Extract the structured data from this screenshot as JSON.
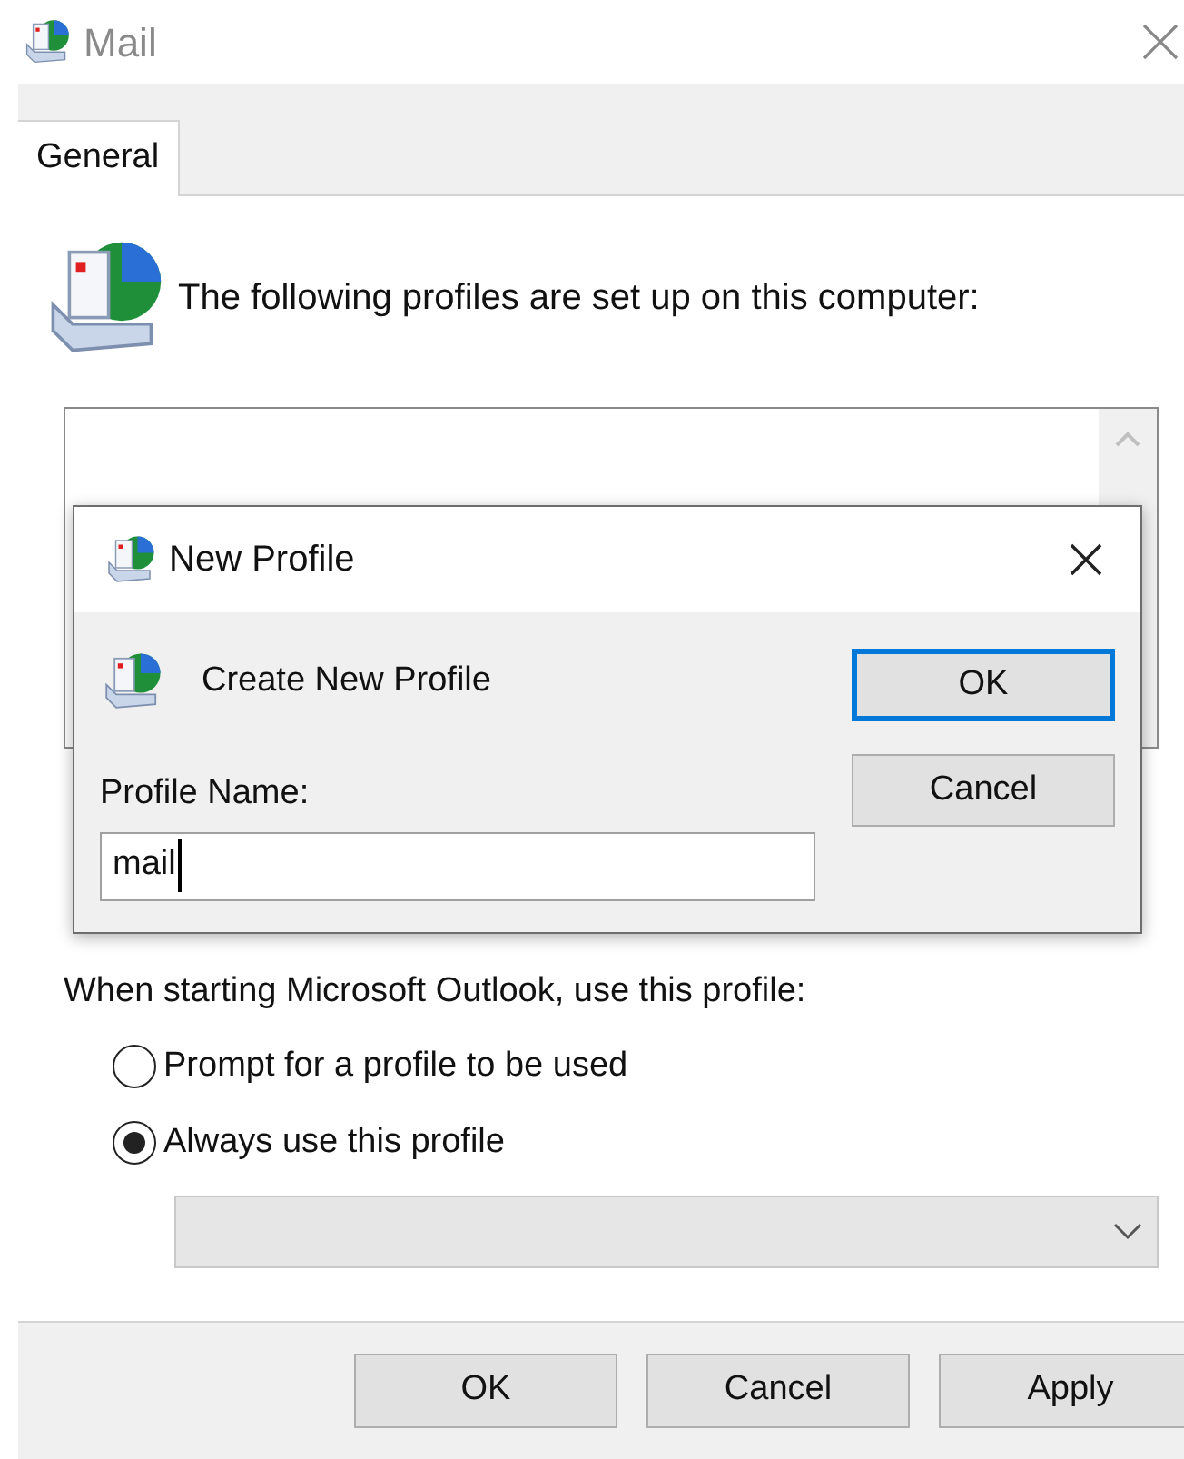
{
  "window": {
    "title": "Mail"
  },
  "tabs": [
    {
      "label": "General",
      "selected": true
    }
  ],
  "profiles": {
    "heading": "The following profiles are set up on this computer:"
  },
  "dialog": {
    "title": "New Profile",
    "heading": "Create New Profile",
    "field_label": "Profile Name:",
    "field_value": "mail",
    "buttons": [
      {
        "label": "OK",
        "selected": true
      },
      {
        "label": "Cancel",
        "selected": false
      }
    ]
  },
  "startup": {
    "label": "When starting Microsoft Outlook, use this profile:",
    "options": [
      {
        "label": "Prompt for a profile to be used",
        "selected": false
      },
      {
        "label": "Always use this profile",
        "selected": true
      }
    ],
    "dropdown": {
      "disabled": true
    }
  },
  "buttons": [
    "OK",
    "Cancel",
    "Apply"
  ]
}
